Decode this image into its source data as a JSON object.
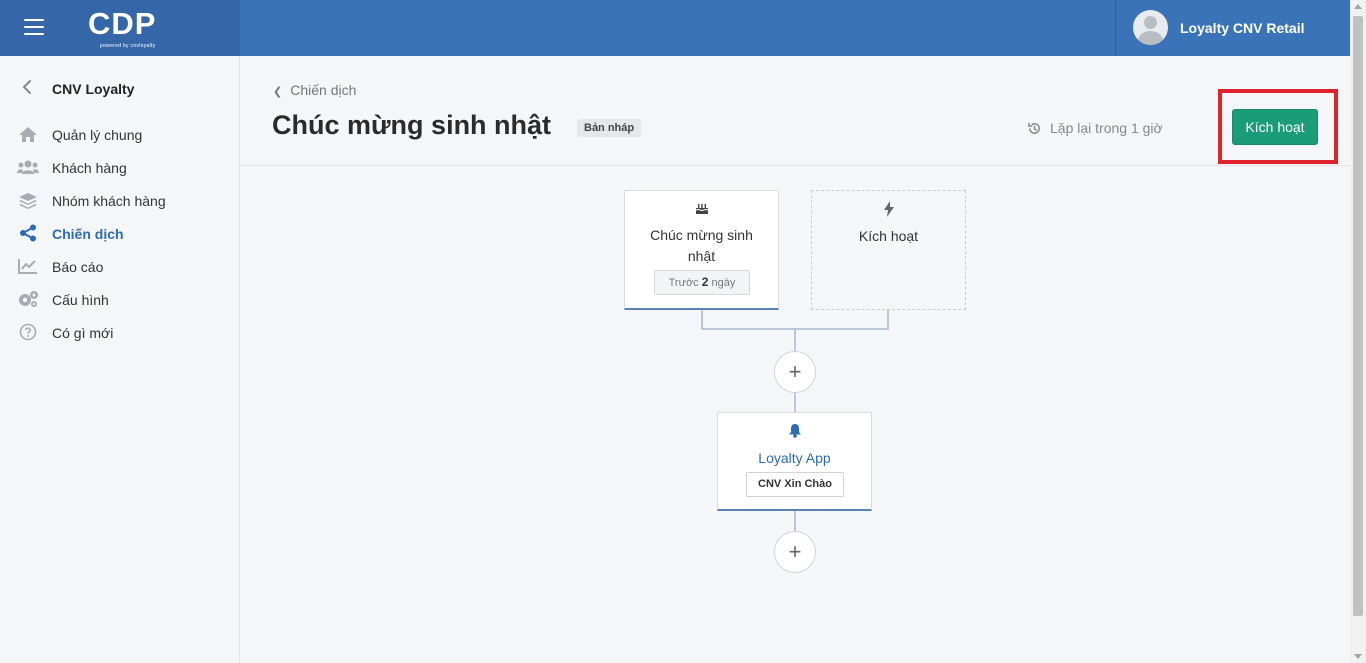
{
  "brand": {
    "logo": "CDP",
    "tagline": "powered by cnvloyalty"
  },
  "user": {
    "name": "Loyalty CNV Retail"
  },
  "sidebar": {
    "org_name": "CNV Loyalty",
    "items": [
      {
        "label": "Quản lý chung",
        "icon": "home-icon",
        "active": false
      },
      {
        "label": "Khách hàng",
        "icon": "users-icon",
        "active": false
      },
      {
        "label": "Nhóm khách hàng",
        "icon": "layers-icon",
        "active": false
      },
      {
        "label": "Chiến dịch",
        "icon": "share-icon",
        "active": true
      },
      {
        "label": "Báo cáo",
        "icon": "chart-line-icon",
        "active": false
      },
      {
        "label": "Cấu hình",
        "icon": "gears-icon",
        "active": false
      },
      {
        "label": "Có gì mới",
        "icon": "question-circle-icon",
        "active": false
      }
    ]
  },
  "header": {
    "breadcrumb": "Chiến dịch",
    "title": "Chúc mừng sinh nhật",
    "status_badge": "Bản nháp",
    "repeat_text": "Lặp lại trong 1 giờ",
    "activate_button": "Kích hoạt"
  },
  "flow": {
    "trigger_card": {
      "icon": "birthday-cake-icon",
      "title": "Chúc mừng sinh nhật",
      "tag_prefix": "Trước",
      "tag_number": "2",
      "tag_suffix": "ngày"
    },
    "activate_card": {
      "icon": "bolt-icon",
      "title": "Kích hoạt"
    },
    "action_card": {
      "icon": "bell-icon",
      "title": "Loyalty App",
      "tag": "CNV Xin Chào"
    },
    "add_step_symbol": "+"
  },
  "colors": {
    "topbar": "#3b73b8",
    "brand_bg": "#3567a8",
    "accent": "#2d6bb3",
    "activate_button": "#1a9d77",
    "highlight_frame": "#e0222c"
  }
}
